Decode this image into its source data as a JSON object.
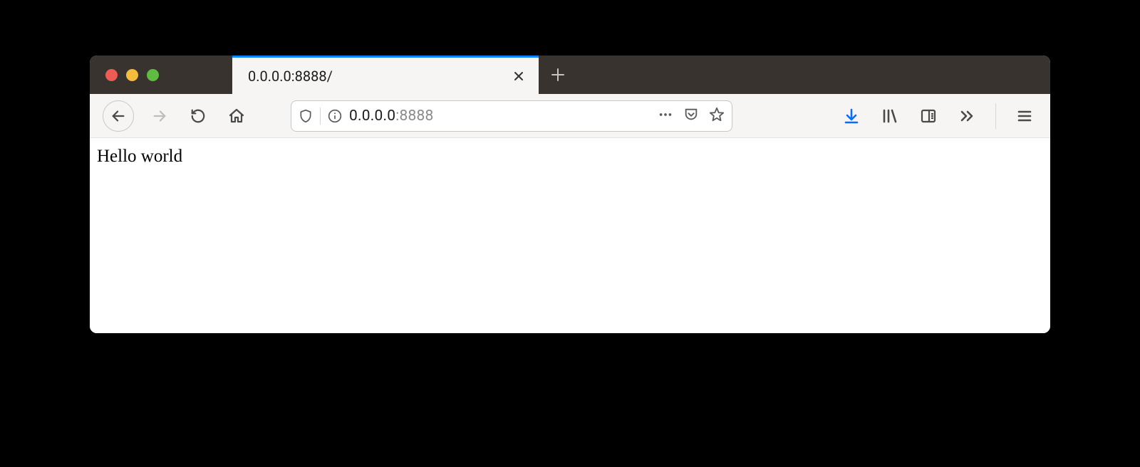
{
  "window": {
    "traffic_lights": {
      "close": "close",
      "minimize": "minimize",
      "zoom": "zoom"
    }
  },
  "tabs": {
    "active": {
      "title": "0.0.0.0:8888/"
    }
  },
  "toolbar": {
    "back": "Back",
    "forward": "Forward",
    "reload": "Reload",
    "home": "Home",
    "downloads": "Downloads",
    "library": "Library",
    "sidebar": "Sidebar",
    "overflow": "More tools",
    "menu": "Menu"
  },
  "urlbar": {
    "shield": "Tracking Protection",
    "info": "Site information",
    "host": "0.0.0.0",
    "port": ":8888",
    "page_actions": "Page actions",
    "pocket": "Save to Pocket",
    "star": "Bookmark this page"
  },
  "page": {
    "body_text": "Hello world"
  },
  "colors": {
    "tab_highlight": "#0a84ff",
    "downloads_icon": "#0a6cff",
    "titlebar_bg": "#38332f",
    "toolbar_bg": "#f6f5f4"
  }
}
